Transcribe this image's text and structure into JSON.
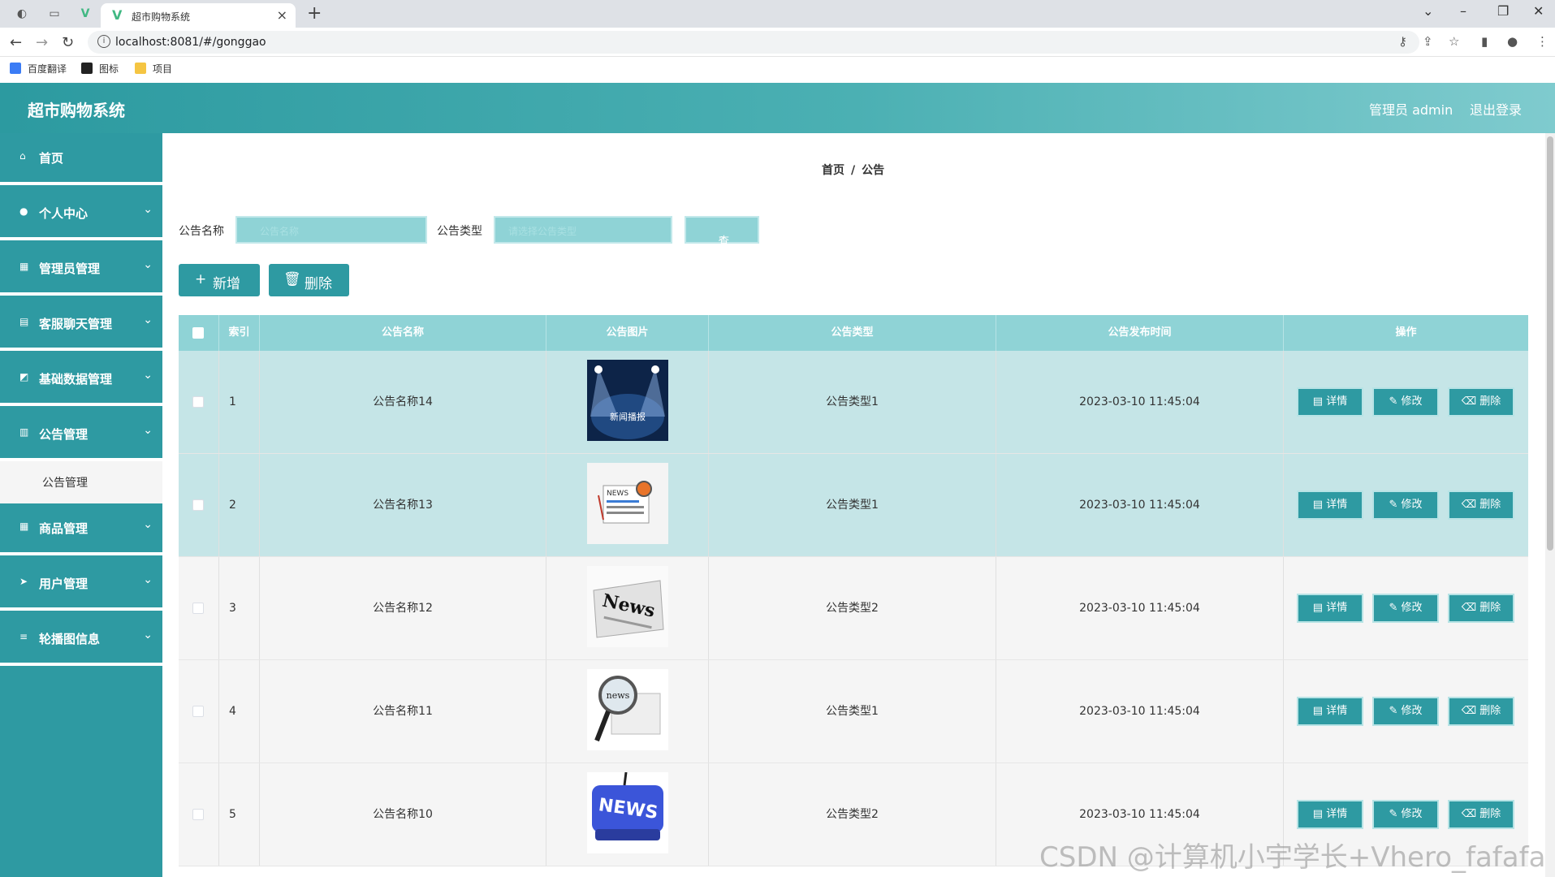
{
  "browser": {
    "tab_title": "超市购物系统",
    "url": "localhost:8081/#/gonggao",
    "bookmarks": [
      "百度翻译",
      "图标",
      "项目"
    ]
  },
  "header": {
    "title": "超市购物系统",
    "user_label": "管理员 admin",
    "logout_label": "退出登录"
  },
  "sidebar": {
    "items": [
      {
        "label": "首页",
        "icon": "home-icon"
      },
      {
        "label": "个人中心",
        "icon": "user-icon"
      },
      {
        "label": "管理员管理",
        "icon": "grid-icon"
      },
      {
        "label": "客服聊天管理",
        "icon": "doc-icon"
      },
      {
        "label": "基础数据管理",
        "icon": "chart-icon"
      },
      {
        "label": "公告管理",
        "icon": "bars-icon"
      },
      {
        "label": "商品管理",
        "icon": "grid-icon"
      },
      {
        "label": "用户管理",
        "icon": "send-icon"
      },
      {
        "label": "轮播图信息",
        "icon": "sliders-icon"
      }
    ],
    "submenu_label": "公告管理"
  },
  "breadcrumb": {
    "home": "首页",
    "sep": "/",
    "current": "公告"
  },
  "filters": {
    "name_label": "公告名称",
    "name_placeholder": "公告名称",
    "type_label": "公告类型",
    "type_placeholder": "请选择公告类型",
    "query_label": "查询"
  },
  "actions": {
    "add_label": "新增",
    "delete_label": "删除"
  },
  "table": {
    "columns": [
      "索引",
      "公告名称",
      "公告图片",
      "公告类型",
      "公告发布时间",
      "操作"
    ],
    "rows": [
      {
        "index": "1",
        "name": "公告名称14",
        "type": "公告类型1",
        "time": "2023-03-10 11:45:04",
        "image": "news-stage"
      },
      {
        "index": "2",
        "name": "公告名称13",
        "type": "公告类型1",
        "time": "2023-03-10 11:45:04",
        "image": "news-paper"
      },
      {
        "index": "3",
        "name": "公告名称12",
        "type": "公告类型2",
        "time": "2023-03-10 11:45:04",
        "image": "news-text"
      },
      {
        "index": "4",
        "name": "公告名称11",
        "type": "公告类型1",
        "time": "2023-03-10 11:45:04",
        "image": "news-magnifier"
      },
      {
        "index": "5",
        "name": "公告名称10",
        "type": "公告类型2",
        "time": "2023-03-10 11:45:04",
        "image": "news-key"
      }
    ],
    "row_actions": {
      "detail": "详情",
      "edit": "修改",
      "delete": "删除"
    }
  },
  "watermark": "CSDN @计算机小宇学长+Vhero_fafafa"
}
